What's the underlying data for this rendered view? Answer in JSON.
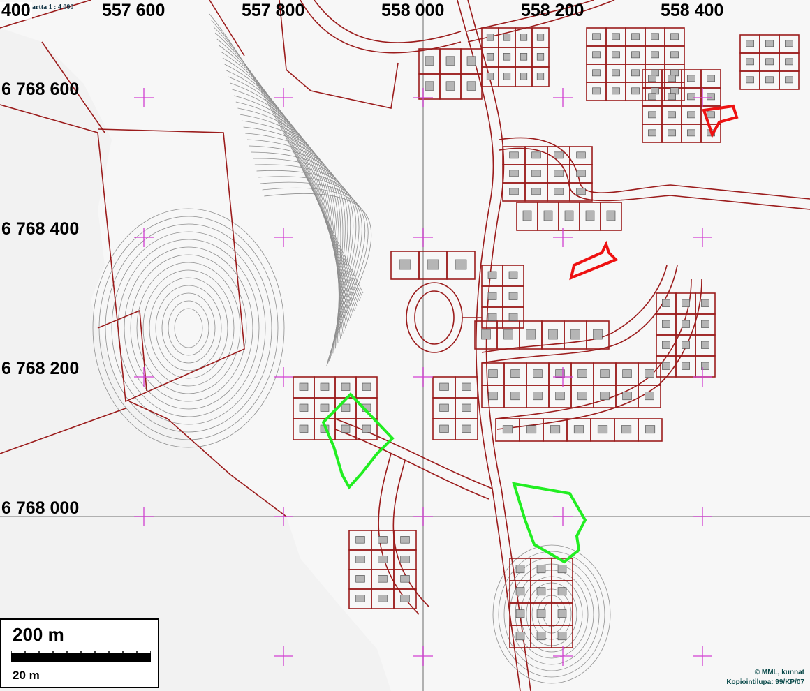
{
  "map": {
    "scale_title": "artta 1 : 4 000",
    "x_labels": [
      "400",
      "557 600",
      "557 800",
      "558 000",
      "558 200",
      "558 400"
    ],
    "y_labels": [
      "6 768 600",
      "6 768 400",
      "6 768 200",
      "6 768 000"
    ],
    "scale_bar": {
      "major_label": "200 m",
      "minor_label": "20 m"
    },
    "copyright_line1": "© MML, kunnat",
    "copyright_line2": "Kopiointilupa: 99/KP/07",
    "colors": {
      "parcel_border": "#9b1c1c",
      "contour": "#8a8a8a",
      "grid_cross": "#d13fd1",
      "highlight_red": "#ee1111",
      "highlight_green": "#22ee22",
      "building": "#b8b8b8",
      "water": "#f4f4f4"
    }
  }
}
